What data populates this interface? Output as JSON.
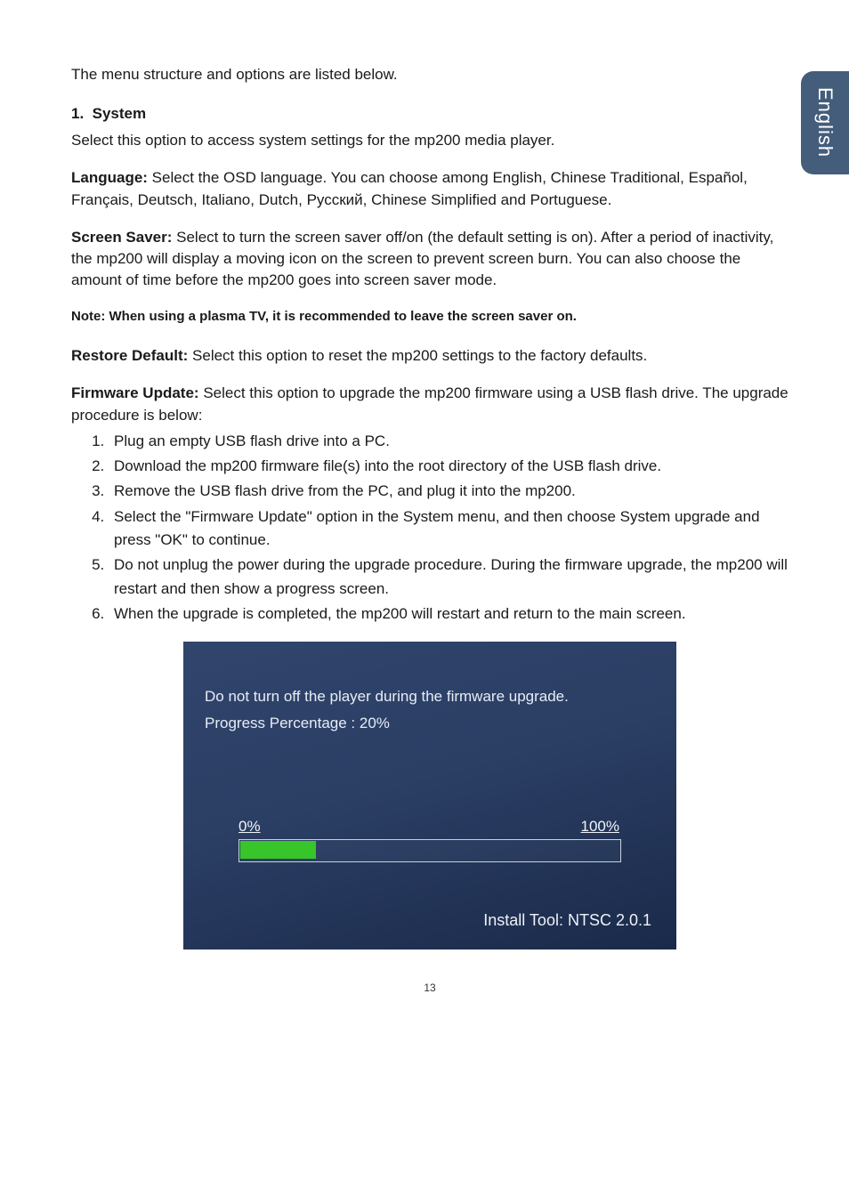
{
  "sideTab": {
    "label": "English"
  },
  "intro": "The menu structure and options are listed below.",
  "sectionNumber": "1.",
  "sectionTitle": "System",
  "sectionLead": "Select this option to access system settings for the mp200 media player.",
  "language": {
    "label": "Language:",
    "body": " Select the OSD language. You can choose among English, Chinese Traditional, Español, Français, Deutsch, Italiano, Dutch, Русский, Chinese Simplified and Portuguese."
  },
  "screenSaver": {
    "label": "Screen Saver:",
    "body": " Select to turn the screen saver off/on (the default setting is on). After a period of inactivity, the mp200 will display a moving icon on the screen to prevent screen burn. You can also choose the amount of time before the mp200 goes into screen saver mode."
  },
  "note": "Note: When using a plasma TV, it is recommended to leave the screen saver on.",
  "restore": {
    "label": "Restore Default:",
    "body": " Select this option to reset the mp200 settings to the factory defaults."
  },
  "firmware": {
    "label": "Firmware Update:",
    "body": " Select this option to upgrade the mp200 firmware using a USB flash drive. The upgrade procedure is below:"
  },
  "steps": [
    "Plug an empty USB flash drive into a PC.",
    "Download the mp200 firmware file(s) into the root directory of the USB flash drive.",
    "Remove the USB flash drive from the PC, and plug it into the mp200.",
    "Select the \"Firmware Update\" option in the System menu, and then choose System upgrade and press \"OK\" to continue.",
    "Do not unplug the power during the upgrade procedure. During the firmware upgrade, the mp200 will restart and then show a progress screen.",
    "When the upgrade is completed, the mp200 will restart and return to the main screen."
  ],
  "fwScreen": {
    "msg": "Do not turn off the player during the firmware upgrade.",
    "progress": "Progress Percentage : 20%",
    "zero": "0%",
    "hundred": "100%",
    "tool": "Install Tool: NTSC 2.0.1"
  },
  "pageNumber": "13"
}
